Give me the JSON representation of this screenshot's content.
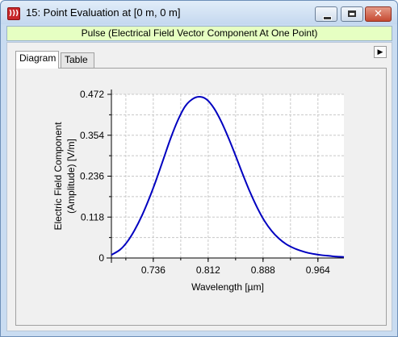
{
  "window": {
    "title": "15: Point Evaluation at [0 m, 0 m]",
    "subtitle": "Pulse (Electrical Field Vector Component At One Point)",
    "icon": "red-app-icon",
    "subtitle_bg": "#e6ffc2"
  },
  "tabs": [
    {
      "label": "Diagram",
      "active": true
    },
    {
      "label": "Table",
      "active": false
    }
  ],
  "chart_data": {
    "type": "line",
    "xlabel": "Wavelength [µm]",
    "ylabel_line1": "Electric Field Component",
    "ylabel_line2": "(Amplitude) [V/m]",
    "xlim": [
      0.678,
      1.0
    ],
    "ylim": [
      0,
      0.472
    ],
    "xticks": [
      "0.736",
      "0.812",
      "0.888",
      "0.964"
    ],
    "yticks": [
      "0",
      "0.118",
      "0.236",
      "0.354",
      "0.472"
    ],
    "grid": true,
    "line_color": "#0000c0",
    "series": [
      {
        "x": [
          0.678,
          0.69,
          0.7,
          0.71,
          0.72,
          0.73,
          0.74,
          0.75,
          0.76,
          0.77,
          0.78,
          0.79,
          0.8,
          0.81,
          0.82,
          0.83,
          0.84,
          0.85,
          0.86,
          0.87,
          0.88,
          0.89,
          0.9,
          0.91,
          0.92,
          0.93,
          0.94,
          0.95,
          0.96,
          0.97,
          0.98,
          0.99,
          1.0
        ],
        "y": [
          0.009,
          0.024,
          0.047,
          0.08,
          0.121,
          0.17,
          0.225,
          0.285,
          0.345,
          0.397,
          0.437,
          0.458,
          0.465,
          0.457,
          0.432,
          0.394,
          0.347,
          0.295,
          0.241,
          0.19,
          0.145,
          0.107,
          0.078,
          0.056,
          0.04,
          0.029,
          0.021,
          0.015,
          0.011,
          0.008,
          0.006,
          0.004,
          0.003
        ]
      }
    ]
  }
}
